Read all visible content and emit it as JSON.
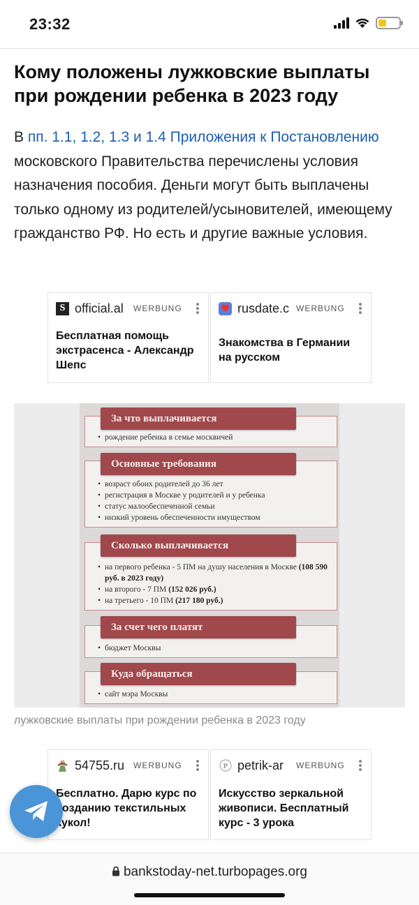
{
  "status_bar": {
    "time": "23:32",
    "battery_color": "#f5c518"
  },
  "article": {
    "title": "Кому положены лужковские выплаты при рождении ребенка в 2023 году",
    "para_prefix": "В ",
    "para_link": "пп. 1.1, 1.2, 1.3 и 1.4 Приложения к Постановлению",
    "para_rest": " московского Правительства перечислены условия назначения пособия. Деньги могут быть выплачены только одному из родителей/усыновителей, имеющему гражданство РФ. Но есть и другие важные условия.",
    "link_color": "#1b5fb2"
  },
  "ads_top": [
    {
      "favicon": "S",
      "domain": "official.al",
      "label": "WERBUNG",
      "text": "Бесплатная помощь экстрасенса - Александр Шепс"
    },
    {
      "favicon": "heart-icon",
      "domain": "rusdate.c",
      "label": "WERBUNG",
      "text": "Знакомства в Германии на русском"
    }
  ],
  "infographic": {
    "accent": "#a0484b",
    "sections": [
      {
        "title": "За что выплачивается",
        "items": [
          "рождение ребенка в семье москвичей"
        ]
      },
      {
        "title": "Основные требования",
        "items": [
          "возраст обоих родителей до 36 лет",
          "регистрация в Москве у родителей и у ребенка",
          "статус малообеспеченной семьи",
          "низкий уровень обеспеченности имуществом"
        ]
      },
      {
        "title": "Сколько выплачивается",
        "items": [
          {
            "text": "на первого ребенка - 5 ПМ на душу населения в Москве ",
            "bold": "(108 590 руб. в 2023 году)"
          },
          {
            "text": "на второго - 7 ПМ ",
            "bold": "(152 026 руб.)"
          },
          {
            "text": "на третьего - 10 ПМ ",
            "bold": "(217 180 руб.)"
          }
        ]
      },
      {
        "title": "За счет чего платят",
        "items": [
          "бюджет Москвы"
        ]
      },
      {
        "title": "Куда обращаться",
        "items": [
          "сайт мэра Москвы"
        ]
      }
    ]
  },
  "caption": "лужковские выплаты при рождении ребенка в 2023 году",
  "ads_bottom": [
    {
      "favicon": "doll-icon",
      "domain": "54755.ru",
      "label": "WERBUNG",
      "text": "Бесплатно. Дарю курс по созданию текстильных кукол!"
    },
    {
      "favicon": "p-logo-icon",
      "domain": "petrik-ar",
      "label": "WERBUNG",
      "text": "Искусство зеркальной живописи. Бесплатный курс - 3 урока"
    }
  ],
  "telegram": {
    "icon": "telegram-plane-icon",
    "color": "#4a95d8"
  },
  "address_bar": {
    "url": "bankstoday-net.turbopages.org"
  }
}
